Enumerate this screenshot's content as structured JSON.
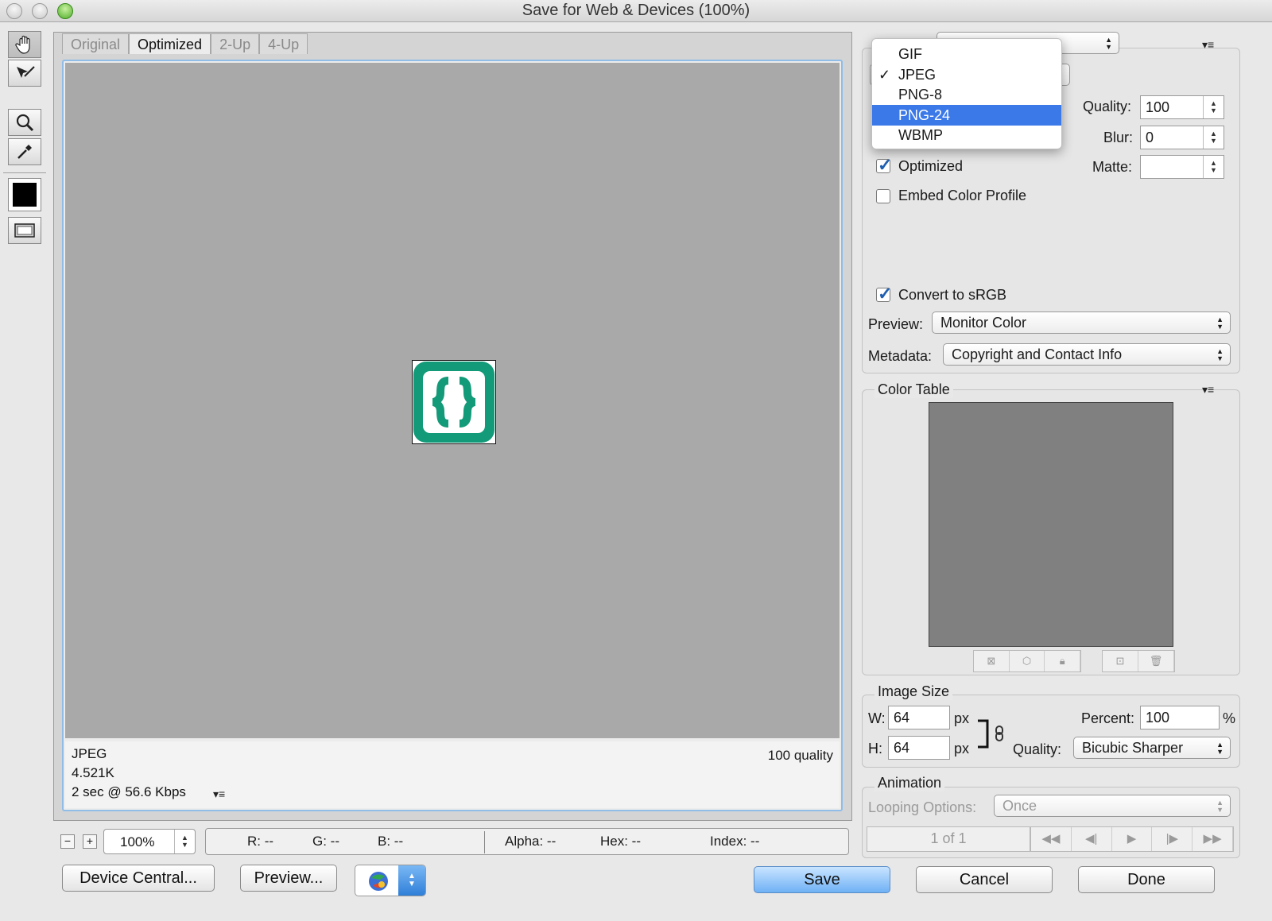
{
  "window": {
    "title": "Save for Web & Devices (100%)"
  },
  "view_tabs": [
    "Original",
    "Optimized",
    "2-Up",
    "4-Up"
  ],
  "active_tab": "Optimized",
  "image_info": {
    "format": "JPEG",
    "size": "4.521K",
    "download_time": "2 sec @ 56.6 Kbps",
    "quality_note": "100 quality"
  },
  "zoom": {
    "value": "100%",
    "minus": "−",
    "plus": "+"
  },
  "readout": {
    "r": "R: --",
    "g": "G: --",
    "b": "B: --",
    "alpha": "Alpha: --",
    "hex": "Hex: --",
    "index": "Index: --"
  },
  "buttons": {
    "device_central": "Device Central...",
    "preview": "Preview...",
    "save": "Save",
    "cancel": "Cancel",
    "done": "Done"
  },
  "format_menu": {
    "items": [
      "GIF",
      "JPEG",
      "PNG-8",
      "PNG-24",
      "WBMP"
    ],
    "checked": "JPEG",
    "highlighted": "PNG-24",
    "check_mark": "✓"
  },
  "settings": {
    "quality_label": "Quality:",
    "quality_value": "100",
    "blur_label": "Blur:",
    "blur_value": "0",
    "matte_label": "Matte:",
    "matte_value": "",
    "optimized_label": "Optimized",
    "optimized_checked": true,
    "embed_profile_label": "Embed Color Profile",
    "embed_profile_checked": false,
    "convert_srgb_label": "Convert to sRGB",
    "convert_srgb_checked": true,
    "preview_label": "Preview:",
    "preview_value": "Monitor Color",
    "metadata_label": "Metadata:",
    "metadata_value": "Copyright and Contact Info"
  },
  "color_table": {
    "title": "Color Table"
  },
  "image_size": {
    "title": "Image Size",
    "w_label": "W:",
    "w_value": "64",
    "w_unit": "px",
    "h_label": "H:",
    "h_value": "64",
    "h_unit": "px",
    "percent_label": "Percent:",
    "percent_value": "100",
    "percent_unit": "%",
    "quality_label": "Quality:",
    "quality_value": "Bicubic Sharper"
  },
  "animation": {
    "title": "Animation",
    "looping_label": "Looping Options:",
    "looping_value": "Once",
    "frame_counter": "1 of 1",
    "controls": [
      "◀◀",
      "◀|",
      "▶",
      "|▶",
      "▶▶"
    ]
  },
  "colors": {
    "accent": "#3b79e8",
    "canvas_bg": "#a9a9a9",
    "logo_green": "#139a78",
    "color_table_fill": "#808080"
  },
  "icons": [
    "hand-tool-icon",
    "slice-select-icon",
    "zoom-icon",
    "eyedropper-icon",
    "eyedropper-color-swatch",
    "toggle-slices-icon",
    "panel-menu-icon",
    "link-chain-icon",
    "browser-icon"
  ]
}
